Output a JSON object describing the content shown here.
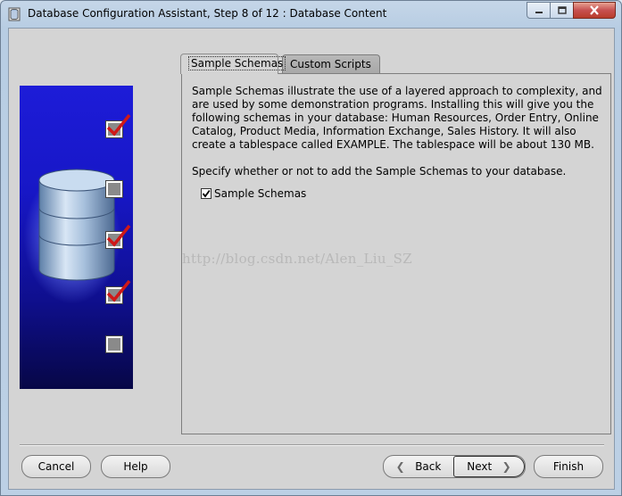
{
  "window": {
    "title": "Database Configuration Assistant, Step 8 of 12 : Database Content",
    "controls": [
      "minimize",
      "maximize",
      "close"
    ]
  },
  "tabs": [
    {
      "label": "Sample Schemas",
      "active": true
    },
    {
      "label": "Custom Scripts",
      "active": false
    }
  ],
  "content": {
    "description": "Sample Schemas illustrate the use of a layered approach to complexity, and are used by some demonstration programs. Installing this will give you the following schemas in your database: Human Resources, Order Entry, Online Catalog, Product Media, Information Exchange, Sales History. It will also create a tablespace called EXAMPLE. The tablespace will be about 130 MB.",
    "instruction": "Specify whether or not to add the Sample Schemas to your database.",
    "checkbox": {
      "label": "Sample Schemas",
      "checked": true
    }
  },
  "side_panel": {
    "steps": [
      {
        "checked": true
      },
      {
        "checked": false
      },
      {
        "checked": true
      },
      {
        "checked": true
      },
      {
        "checked": false
      }
    ]
  },
  "buttons": {
    "cancel": "Cancel",
    "help": "Help",
    "back": "Back",
    "next": "Next",
    "finish": "Finish"
  },
  "watermark": "http://blog.csdn.net/Alen_Liu_SZ",
  "colors": {
    "accent_blue": "#1717c6",
    "check_red": "#d01818",
    "close_button": "#c75050"
  }
}
